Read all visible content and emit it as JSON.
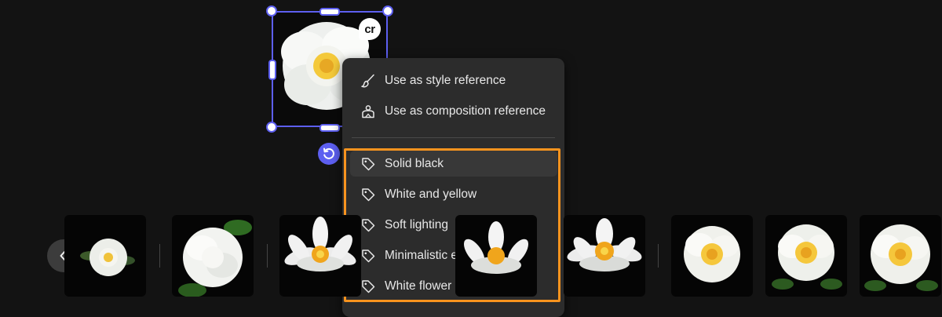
{
  "canvas": {
    "badge_text": "cr"
  },
  "menu": {
    "reference_items": [
      {
        "label": "Use as style reference",
        "icon": "brush-icon"
      },
      {
        "label": "Use as composition reference",
        "icon": "composition-icon"
      }
    ],
    "tag_items": [
      {
        "label": "Solid black",
        "icon": "tag-icon"
      },
      {
        "label": "White and yellow",
        "icon": "tag-icon"
      },
      {
        "label": "Soft lighting",
        "icon": "tag-icon"
      },
      {
        "label": "Minimalistic elegance",
        "icon": "tag-icon"
      },
      {
        "label": "White flower",
        "icon": "tag-icon"
      }
    ]
  },
  "colors": {
    "selection": "#5d5ff0",
    "highlight": "#f7931e",
    "menu_bg": "#2c2c2c",
    "background": "#131313"
  },
  "strip": {
    "thumbnails": [
      {
        "name": "thumb-camellia-small",
        "kind": "camellia"
      },
      {
        "name": "thumb-camellia-leaves",
        "kind": "camellia"
      },
      {
        "name": "thumb-lotus-1",
        "kind": "lotus"
      },
      {
        "name": "thumb-lotus-2",
        "kind": "lotus"
      },
      {
        "name": "thumb-lotus-3",
        "kind": "lotus"
      },
      {
        "name": "thumb-camellia-yellow-1",
        "kind": "camellia"
      },
      {
        "name": "thumb-camellia-yellow-2",
        "kind": "camellia"
      },
      {
        "name": "thumb-camellia-yellow-3",
        "kind": "camellia"
      }
    ]
  }
}
